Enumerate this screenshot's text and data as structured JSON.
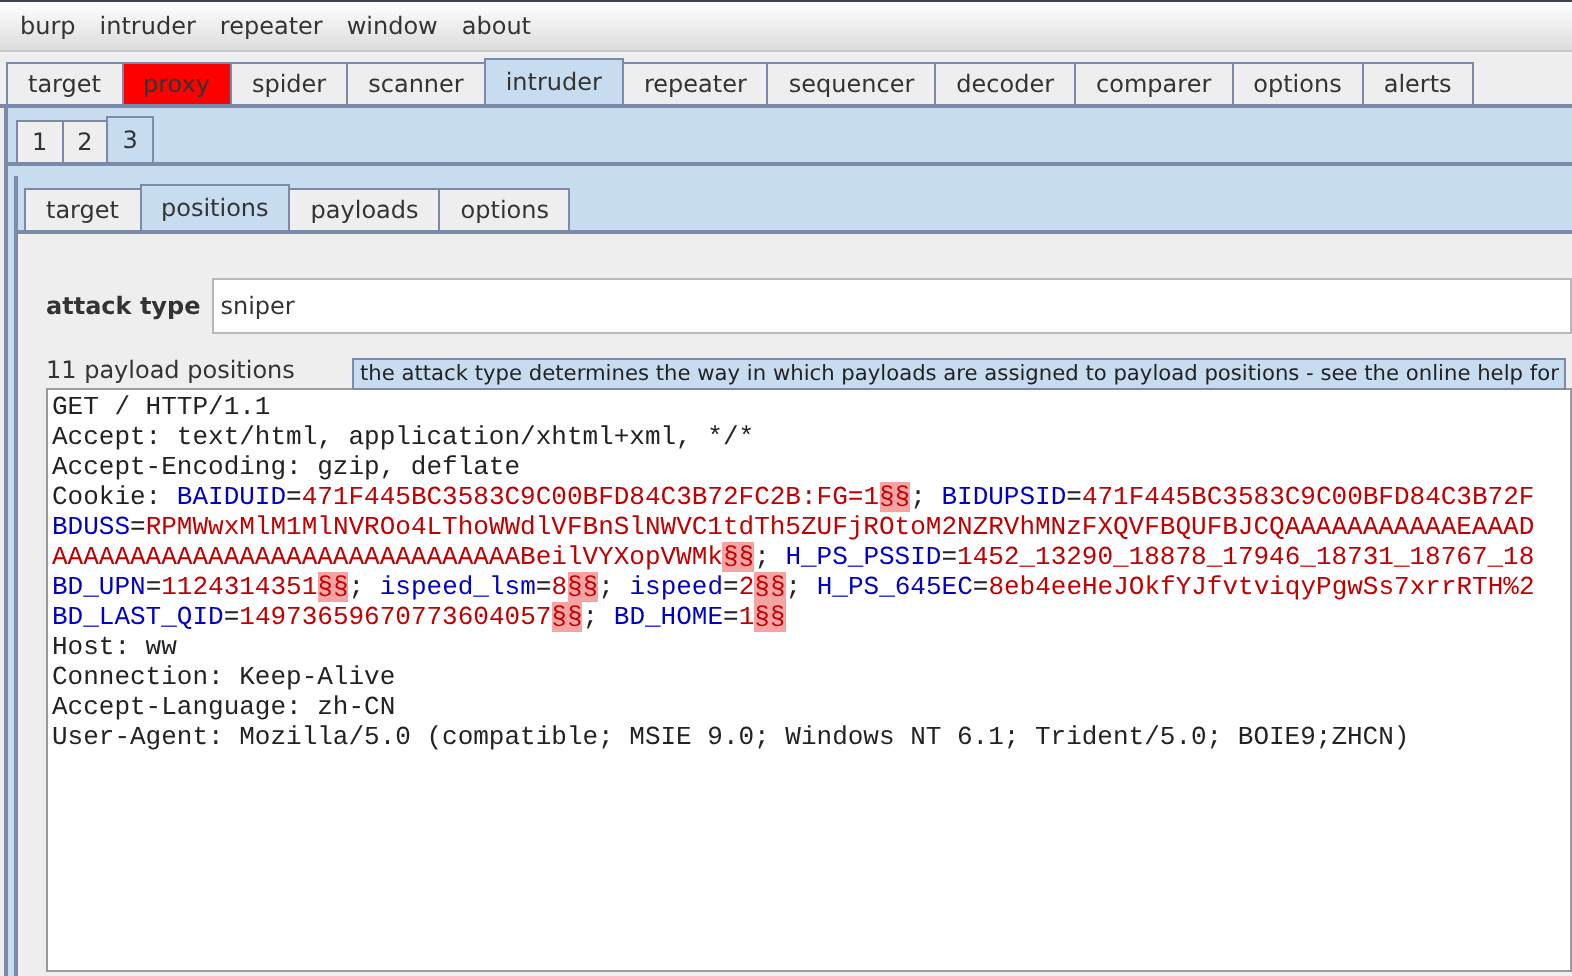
{
  "menu": [
    {
      "label": "burp"
    },
    {
      "label": "intruder"
    },
    {
      "label": "repeater"
    },
    {
      "label": "window"
    },
    {
      "label": "about"
    }
  ],
  "main_tabs": [
    {
      "label": "target",
      "selected": false,
      "flagged": false
    },
    {
      "label": "proxy",
      "selected": false,
      "flagged": true
    },
    {
      "label": "spider",
      "selected": false,
      "flagged": false
    },
    {
      "label": "scanner",
      "selected": false,
      "flagged": false
    },
    {
      "label": "intruder",
      "selected": true,
      "flagged": false
    },
    {
      "label": "repeater",
      "selected": false,
      "flagged": false
    },
    {
      "label": "sequencer",
      "selected": false,
      "flagged": false
    },
    {
      "label": "decoder",
      "selected": false,
      "flagged": false
    },
    {
      "label": "comparer",
      "selected": false,
      "flagged": false
    },
    {
      "label": "options",
      "selected": false,
      "flagged": false
    },
    {
      "label": "alerts",
      "selected": false,
      "flagged": false
    }
  ],
  "attack_tabs": [
    {
      "label": "1",
      "selected": false
    },
    {
      "label": "2",
      "selected": false
    },
    {
      "label": "3",
      "selected": true
    }
  ],
  "section_tabs": [
    {
      "label": "target",
      "selected": false
    },
    {
      "label": "positions",
      "selected": true
    },
    {
      "label": "payloads",
      "selected": false
    },
    {
      "label": "options",
      "selected": false
    }
  ],
  "attack_type": {
    "label": "attack type",
    "value": "sniper"
  },
  "positions_count": "11 payload positions",
  "tooltip": "the attack type determines the way in which payloads are assigned to payload positions - see the online help for",
  "request_lines": [
    [
      {
        "kind": "plain",
        "text": "GET / HTTP/1.1"
      }
    ],
    [
      {
        "kind": "plain",
        "text": "Accept: text/html, application/xhtml+xml, */*"
      }
    ],
    [
      {
        "kind": "plain",
        "text": "Accept-Encoding: gzip, deflate"
      }
    ],
    [
      {
        "kind": "plain",
        "text": "Cookie: "
      },
      {
        "kind": "name",
        "text": "BAIDUID"
      },
      {
        "kind": "plain",
        "text": "="
      },
      {
        "kind": "value",
        "text": "471F445BC3583C9C00BFD84C3B72FC2B:FG=1"
      },
      {
        "kind": "marker",
        "text": "§§"
      },
      {
        "kind": "plain",
        "text": "; "
      },
      {
        "kind": "name",
        "text": "BIDUPSID"
      },
      {
        "kind": "plain",
        "text": "="
      },
      {
        "kind": "value",
        "text": "471F445BC3583C9C00BFD84C3B72F"
      }
    ],
    [
      {
        "kind": "name",
        "text": "BDUSS"
      },
      {
        "kind": "plain",
        "text": "="
      },
      {
        "kind": "value",
        "text": "RPMWwxMlM1MlNVROo4LThoWWdlVFBnSlNWVC1tdTh5ZUFjROtoM2NZRVhMNzFXQVFBQUFBJCQAAAAAAAAAAAEAAAD"
      }
    ],
    [
      {
        "kind": "value",
        "text": "AAAAAAAAAAAAAAAAAAAAAAAAAAAAAABeilVYXopVWMk"
      },
      {
        "kind": "marker",
        "text": "§§"
      },
      {
        "kind": "plain",
        "text": "; "
      },
      {
        "kind": "name",
        "text": "H_PS_PSSID"
      },
      {
        "kind": "plain",
        "text": "="
      },
      {
        "kind": "value",
        "text": "1452_13290_18878_17946_18731_18767_18"
      }
    ],
    [
      {
        "kind": "name",
        "text": "BD_UPN"
      },
      {
        "kind": "plain",
        "text": "="
      },
      {
        "kind": "value",
        "text": "1124314351"
      },
      {
        "kind": "marker",
        "text": "§§"
      },
      {
        "kind": "plain",
        "text": "; "
      },
      {
        "kind": "name",
        "text": "ispeed_lsm"
      },
      {
        "kind": "plain",
        "text": "="
      },
      {
        "kind": "value",
        "text": "8"
      },
      {
        "kind": "marker",
        "text": "§§"
      },
      {
        "kind": "plain",
        "text": "; "
      },
      {
        "kind": "name",
        "text": "ispeed"
      },
      {
        "kind": "plain",
        "text": "="
      },
      {
        "kind": "value",
        "text": "2"
      },
      {
        "kind": "marker",
        "text": "§§"
      },
      {
        "kind": "plain",
        "text": "; "
      },
      {
        "kind": "name",
        "text": "H_PS_645EC"
      },
      {
        "kind": "plain",
        "text": "="
      },
      {
        "kind": "value",
        "text": "8eb4eeHeJOkfYJfvtviqyPgwSs7xrrRTH%2"
      }
    ],
    [
      {
        "kind": "name",
        "text": "BD_LAST_QID"
      },
      {
        "kind": "plain",
        "text": "="
      },
      {
        "kind": "value",
        "text": "14973659670773604057"
      },
      {
        "kind": "marker",
        "text": "§§"
      },
      {
        "kind": "plain",
        "text": "; "
      },
      {
        "kind": "name",
        "text": "BD_HOME"
      },
      {
        "kind": "plain",
        "text": "="
      },
      {
        "kind": "value",
        "text": "1"
      },
      {
        "kind": "marker",
        "text": "§§"
      }
    ],
    [
      {
        "kind": "plain",
        "text": "Host: ww"
      }
    ],
    [
      {
        "kind": "plain",
        "text": "Connection: Keep-Alive"
      }
    ],
    [
      {
        "kind": "plain",
        "text": "Accept-Language: zh-CN"
      }
    ],
    [
      {
        "kind": "plain",
        "text": "User-Agent: Mozilla/5.0 (compatible; MSIE 9.0; Windows NT 6.1; Trident/5.0; BOIE9;ZHCN)"
      }
    ]
  ]
}
